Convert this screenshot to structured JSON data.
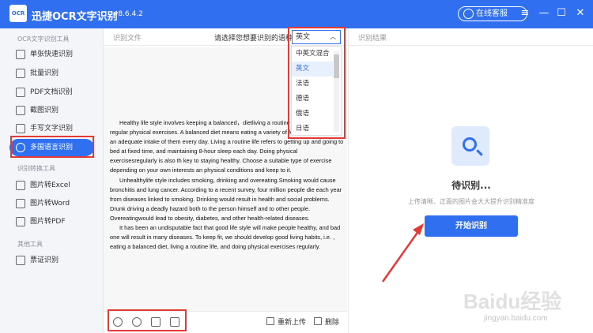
{
  "app": {
    "logo_text": "OCR",
    "name": "迅捷OCR文字识别",
    "version": "v8.6.4.2",
    "service_label": "在线客服",
    "window_controls": [
      "≡",
      "—",
      "☐",
      "✕"
    ]
  },
  "sidebar": {
    "sections": [
      {
        "title": "OCR文字识别工具",
        "items": [
          {
            "label": "单张快速识别",
            "icon": "scan-icon"
          },
          {
            "label": "批量识别",
            "icon": "batch-icon"
          },
          {
            "label": "PDF文档识别",
            "icon": "pdf-icon"
          },
          {
            "label": "截图识别",
            "icon": "screenshot-icon"
          },
          {
            "label": "手写文字识别",
            "icon": "handwriting-icon"
          },
          {
            "label": "多国语言识别",
            "icon": "globe-icon",
            "active": true
          }
        ]
      },
      {
        "title": "识别转换工具",
        "items": [
          {
            "label": "图片转Excel",
            "icon": "excel-icon"
          },
          {
            "label": "图片转Word",
            "icon": "word-icon"
          },
          {
            "label": "图片转PDF",
            "icon": "pdf-file-icon"
          }
        ]
      },
      {
        "title": "其他工具",
        "items": [
          {
            "label": "票证识别",
            "icon": "ticket-icon"
          }
        ]
      }
    ]
  },
  "doc_panel": {
    "header": "识别文件",
    "prompt": "请选择您想要识别的语种",
    "paragraphs": [
      "Healthy life style involves keeping a balanced，dietliving a routine life and taking regular physical exercises. A balanced diet means eating a variety of foods in order to get an adequate intake of them every day. Living a routine life refers to getting up and going to bed at fixed time, and maintaining 8-hour sleep each day. Doing physical exercisesregularly is also th key to staying healthy. Choose a suitable type of exercise depending on your own interests an physical conditions and keep to it.",
      "Unhealthylife style includes smoking, drinking and overeating.Smoking would cause bronchitis and lung cancer. According to a recent survey, four million people die each year from diseases linked to smoking. Drinking would result in health and social problems. Drunk driving a deadly hazard both to the person himself and to other people. Overeatingwould lead to obesity, diabetes, and other health-related diseases.",
      "It has been an undisputable fact that good life style will make people healthy, and bad one will result in many diseases. To keep fit, we should develop good living habits, i.e. , eating a balanced diet, living a routine life, and doing physical exercises regularly."
    ],
    "footer": {
      "reupload_label": "重新上传",
      "delete_label": "删除"
    }
  },
  "language": {
    "selected": "英文",
    "options": [
      "中英文混合",
      "英文",
      "法语",
      "德语",
      "俄语",
      "日语"
    ]
  },
  "result_panel": {
    "header": "识别结果",
    "status": "待识别...",
    "tip": "上传清晰、正面的图片会大大提升识别精准度",
    "start_button": "开始识别"
  },
  "watermark": {
    "brand": "Baidu经验",
    "url": "jingyan.baidu.com"
  },
  "colors": {
    "primary": "#2f6ff0",
    "annotation_red": "#e53935"
  }
}
